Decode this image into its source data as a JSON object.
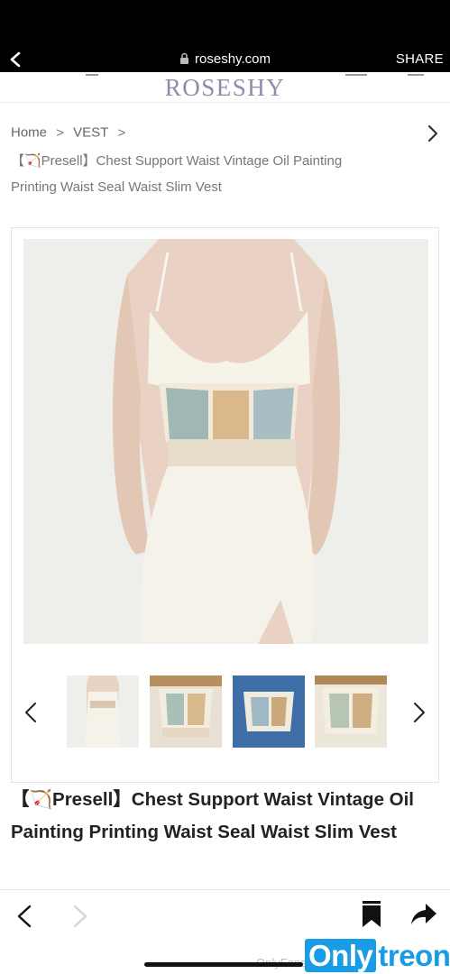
{
  "browser": {
    "url": "roseshy.com",
    "share_label": "SHARE"
  },
  "site": {
    "logo": "ROSESHY"
  },
  "breadcrumb": {
    "home": "Home",
    "category": "VEST",
    "separator": ">",
    "current": "【🏹Presell】Chest Support Waist Vintage Oil Painting Printing Waist Seal Waist Slim Vest"
  },
  "product": {
    "title": "【🏹Presell】Chest Support Waist Vintage Oil Painting Printing Waist Seal Waist Slim Vest",
    "thumbnails": [
      {
        "icon": "thumbnail-dress-front"
      },
      {
        "icon": "thumbnail-corset-front"
      },
      {
        "icon": "thumbnail-corset-on-denim"
      },
      {
        "icon": "thumbnail-corset-side"
      }
    ]
  },
  "watermark": {
    "small_text": "OnlyFans",
    "brand_part1": "Only",
    "brand_part2": "treon"
  },
  "icons": {
    "back": "chevron-left-icon",
    "lock": "lock-icon",
    "next": "chevron-right-icon",
    "bookmark": "bookmark-icon",
    "share": "share-arrow-icon"
  },
  "colors": {
    "logo": "#8e8ca8",
    "browser_bar": "#000000",
    "watermark": "#1a9be6"
  }
}
